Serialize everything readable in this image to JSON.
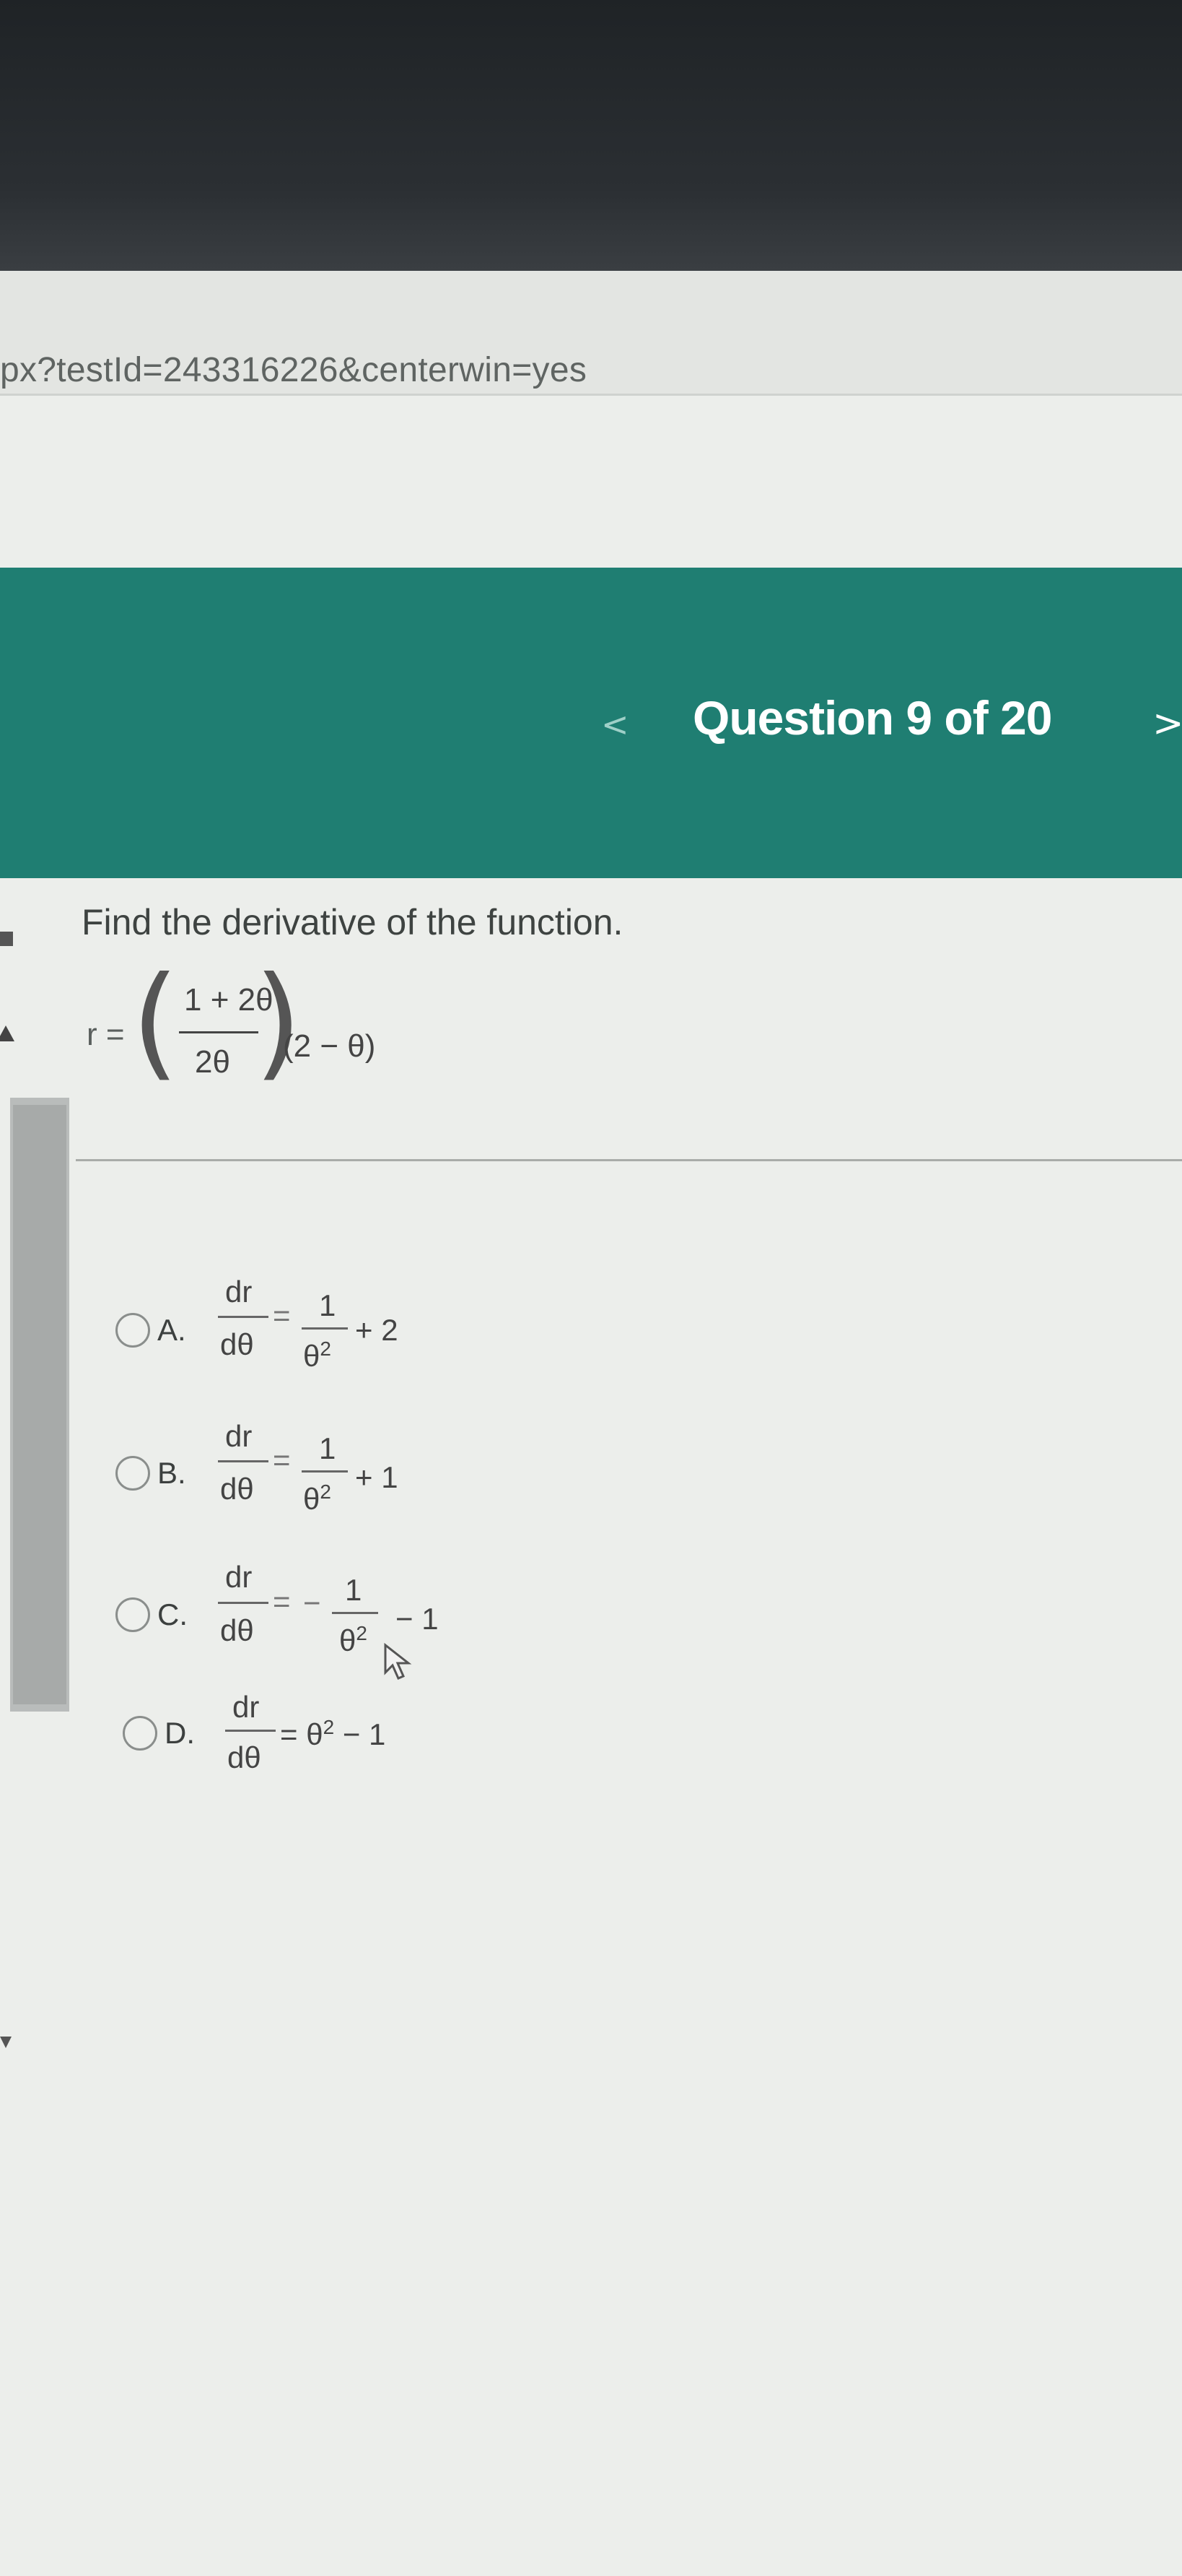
{
  "browser": {
    "url": "px?testId=243316226&centerwin=yes"
  },
  "header": {
    "title": "Question 9 of 20",
    "prev_icon": "chevron-left-icon",
    "next_icon": "chevron-right-icon",
    "prev_glyph": "<",
    "next_glyph": ">",
    "color": "#1f7e72"
  },
  "question": {
    "prompt": "Find the derivative of the function.",
    "function": {
      "lhs": "r =",
      "numerator": "1 + 2θ",
      "denominator": "2θ",
      "factor": "(2 − θ)"
    }
  },
  "options": [
    {
      "letter": "A.",
      "lhs_num": "dr",
      "lhs_den": "dθ",
      "eq": "=",
      "rhs_num": "1",
      "rhs_den": "θ",
      "rhs_den_sup": "2",
      "tail": "+ 2",
      "sign": "",
      "selected": false
    },
    {
      "letter": "B.",
      "lhs_num": "dr",
      "lhs_den": "dθ",
      "eq": "=",
      "rhs_num": "1",
      "rhs_den": "θ",
      "rhs_den_sup": "2",
      "tail": "+ 1",
      "sign": "",
      "selected": false
    },
    {
      "letter": "C.",
      "lhs_num": "dr",
      "lhs_den": "dθ",
      "eq": "=",
      "rhs_num": "1",
      "rhs_den": "θ",
      "rhs_den_sup": "2",
      "tail": "− 1",
      "sign": "−",
      "selected": false
    },
    {
      "letter": "D.",
      "lhs_num": "dr",
      "lhs_den": "dθ",
      "eq": "= θ",
      "eq_sup": "2",
      "tail": "− 1",
      "selected": false
    }
  ]
}
